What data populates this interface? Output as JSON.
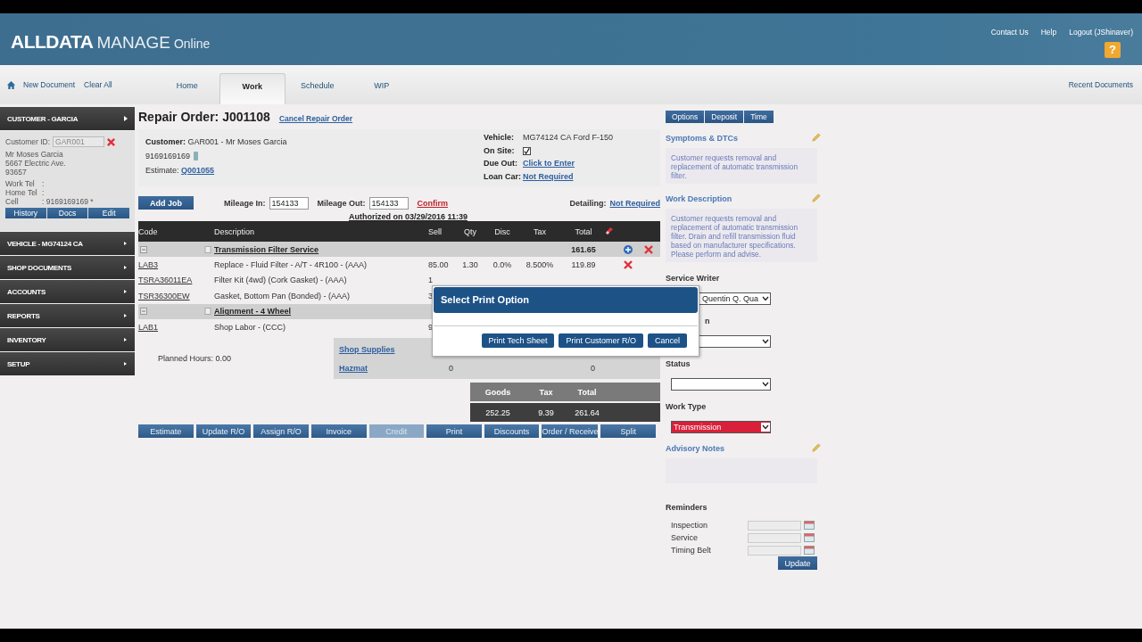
{
  "header": {
    "logo_bold": "ALLDATA",
    "logo_main": "MANAGE",
    "logo_sub": "Online",
    "links": [
      "Contact Us",
      "Help",
      "Logout (JShinaver)"
    ],
    "help_glyph": "?"
  },
  "toolbar": {
    "links": [
      "New Document",
      "Clear All"
    ],
    "tabs": [
      {
        "label": "Home",
        "selected": false
      },
      {
        "label": "Work",
        "selected": true
      },
      {
        "label": "Schedule",
        "selected": false
      },
      {
        "label": "WIP",
        "selected": false
      }
    ],
    "recent": "Recent Documents"
  },
  "sidebar": {
    "sections": [
      {
        "title": "CUSTOMER - GARCIA",
        "expanded": true
      },
      {
        "title": "VEHICLE - MG74124 CA",
        "expanded": false
      },
      {
        "title": "SHOP DOCUMENTS",
        "expanded": false
      },
      {
        "title": "ACCOUNTS",
        "expanded": false
      },
      {
        "title": "REPORTS",
        "expanded": false
      },
      {
        "title": "INVENTORY",
        "expanded": false
      },
      {
        "title": "SETUP",
        "expanded": false
      }
    ],
    "customer": {
      "id_label": "Customer ID:",
      "id_value": "GAR001",
      "address": [
        "Mr Moses Garcia",
        "5667 Electric Ave.",
        "93657"
      ],
      "phones": [
        {
          "label": "Work Tel",
          "value": ":"
        },
        {
          "label": "Home Tel",
          "value": ":"
        },
        {
          "label": "Cell",
          "value": ": 9169169169 *"
        }
      ],
      "buttons": [
        "History",
        "Docs",
        "Edit"
      ]
    }
  },
  "order": {
    "title": "Repair Order: J001108",
    "cancel": "Cancel Repair Order",
    "customer_label": "Customer:",
    "customer_value": "GAR001 - Mr Moses Garcia",
    "phone": "9169169169",
    "estimate_label": "Estimate:",
    "estimate_value": "Q001055",
    "fields": [
      {
        "kind": "text",
        "label": "Vehicle:",
        "value": "MG74124 CA Ford F-150"
      },
      {
        "kind": "checkbox",
        "label": "On Site:",
        "checked": true
      },
      {
        "kind": "link",
        "label": "Due Out:",
        "value": "Click to Enter"
      },
      {
        "kind": "link",
        "label": "Loan Car:",
        "value": "Not Required"
      }
    ],
    "add_job": "Add Job",
    "mileage_in_label": "Mileage In:",
    "mileage_in": "154133",
    "mileage_out_label": "Mileage Out:",
    "mileage_out": "154133",
    "confirm": "Confirm",
    "detailing_label": "Detailing:",
    "detailing_value": "Not Required",
    "authorized": "Authorized on 03/29/2016 11:39"
  },
  "table": {
    "columns": [
      "Code",
      "Description",
      "Sell",
      "Qty",
      "Disc",
      "Tax",
      "Total"
    ],
    "rows": [
      {
        "kind": "job",
        "title": "Transmission Filter Service",
        "total": "161.65",
        "can_add": true,
        "can_delete": true
      },
      {
        "kind": "item",
        "code": "LAB3",
        "description": "Replace - Fluid Filter - A/T - 4R100 - (AAA)",
        "sell": "85.00",
        "qty": "1.30",
        "disc": "0.0%",
        "tax": "8.500%",
        "total": "119.89",
        "can_delete": true
      },
      {
        "kind": "item",
        "code": "TSRA36011EA",
        "description": "Filter Kit (4wd) (Cork Gasket) - (AAA)",
        "sell": "1",
        "can_delete": false
      },
      {
        "kind": "item",
        "code": "TSR36300EW",
        "description": "Gasket, Bottom Pan (Bonded) - (AAA)",
        "sell": "3"
      },
      {
        "kind": "job",
        "title": "Alignment - 4 Wheel"
      },
      {
        "kind": "item",
        "code": "LAB1",
        "description": "Shop Labor - (CCC)",
        "sell": "9"
      }
    ]
  },
  "planned_hours": "Planned Hours: 0.00",
  "supplies": [
    {
      "label": "Shop Supplies"
    },
    {
      "label": "Hazmat",
      "col_1": "0",
      "col_2": "0"
    }
  ],
  "totals": {
    "labels": [
      "Goods",
      "Tax",
      "Total"
    ],
    "values": [
      "252.25",
      "9.39",
      "261.64"
    ]
  },
  "actions": [
    {
      "label": "Estimate",
      "disabled": false
    },
    {
      "label": "Update R/O",
      "disabled": false
    },
    {
      "label": "Assign R/O",
      "disabled": false
    },
    {
      "label": "Invoice",
      "disabled": false
    },
    {
      "label": "Credit",
      "disabled": true
    },
    {
      "label": "Print",
      "disabled": false
    },
    {
      "label": "Discounts",
      "disabled": false
    },
    {
      "label": "Order / Receive",
      "disabled": false
    },
    {
      "label": "Split",
      "disabled": false
    }
  ],
  "dialog": {
    "title": "Select Print Option",
    "buttons": [
      "Print Tech Sheet",
      "Print Customer R/O",
      "Cancel"
    ]
  },
  "right": {
    "tabs": [
      "Options",
      "Deposit",
      "Time"
    ],
    "notes": [
      {
        "title": "Symptoms & DTCs",
        "text": "Customer requests removal and replacement of automatic transmission filter."
      },
      {
        "title": "Work Description",
        "text": "Customer requests removal and replacement of automatic transmission filter. Drain and refill transmission fluid based on manufacturer specifications. Please perform and advise."
      }
    ],
    "selects": [
      {
        "label": "Service Writer",
        "value": "Quentin Q. Qua"
      },
      {
        "label": "n",
        "covered": true
      },
      {
        "label": "Status"
      },
      {
        "label": "Work Type",
        "value": "Transmission",
        "color": "#d9203a"
      }
    ],
    "advisory": "Advisory Notes",
    "reminders_title": "Reminders",
    "reminders": [
      "Inspection",
      "Service",
      "Timing Belt"
    ],
    "update": "Update"
  }
}
